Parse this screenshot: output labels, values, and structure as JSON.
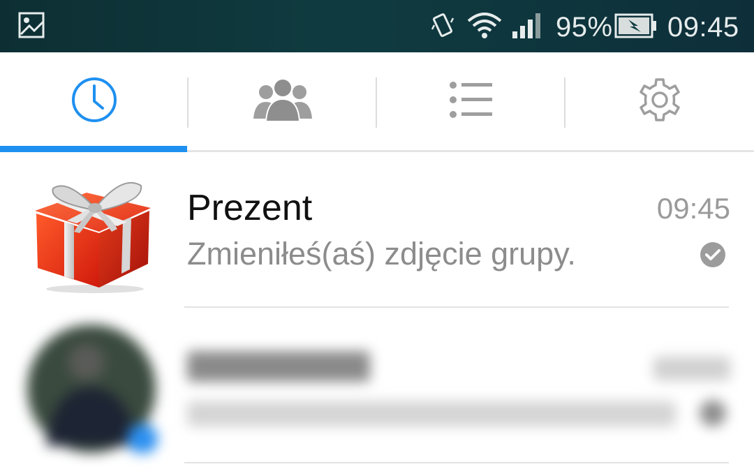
{
  "status_bar": {
    "battery_percent": "95%",
    "clock": "09:45",
    "icons": [
      "gallery-icon",
      "vibrate-icon",
      "wifi-icon",
      "signal-icon",
      "battery-charging-icon"
    ]
  },
  "tabs": [
    {
      "name": "recent",
      "icon": "clock-icon",
      "active": true
    },
    {
      "name": "groups",
      "icon": "contacts-icon",
      "active": false
    },
    {
      "name": "lists",
      "icon": "list-icon",
      "active": false
    },
    {
      "name": "settings",
      "icon": "gear-icon",
      "active": false
    }
  ],
  "accent_color": "#1e90f0",
  "chats": [
    {
      "title": "Prezent",
      "time": "09:45",
      "preview": "Zmieniłeś(aś) zdjęcie grupy.",
      "status_icon": "delivered-check-icon",
      "avatar_icon": "gift-icon"
    },
    {
      "blurred": true,
      "avatar_icon": "contact-photo"
    }
  ]
}
